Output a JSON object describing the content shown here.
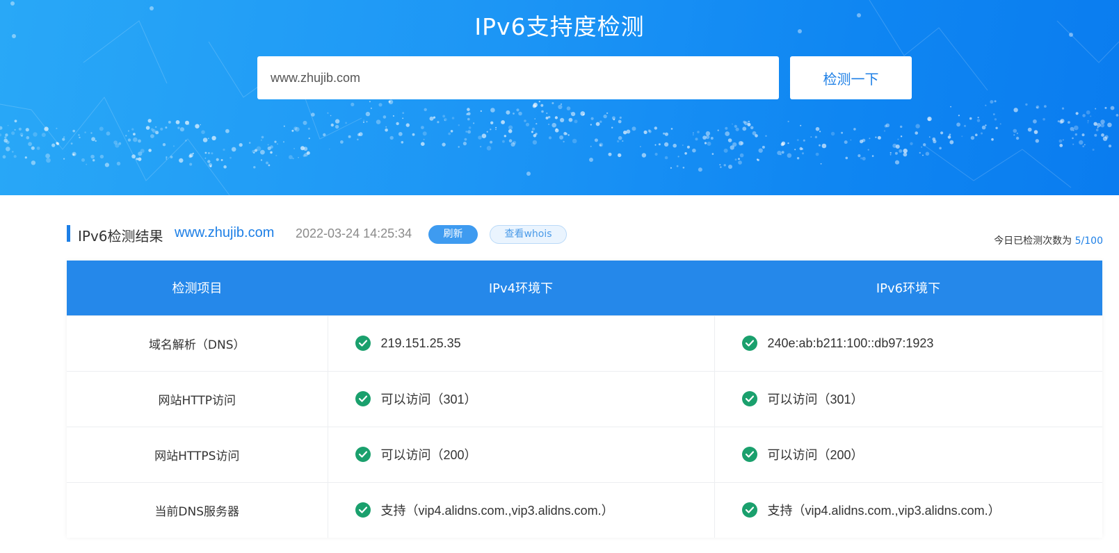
{
  "hero": {
    "title": "IPv6支持度检测",
    "search_value": "www.zhujib.com",
    "search_button": "检测一下"
  },
  "result": {
    "title": "IPv6检测结果",
    "domain": "www.zhujib.com",
    "timestamp": "2022-03-24 14:25:34",
    "refresh_label": "刷新",
    "whois_label": "查看whois",
    "count_label": "今日已检测次数为",
    "count_value": "5/100"
  },
  "table": {
    "headers": [
      "检测项目",
      "IPv4环境下",
      "IPv6环境下"
    ],
    "rows": [
      {
        "item": "域名解析（DNS）",
        "ipv4": "219.151.25.35",
        "ipv6": "240e:ab:b211:100::db97:1923"
      },
      {
        "item": "网站HTTP访问",
        "ipv4": "可以访问（301）",
        "ipv6": "可以访问（301）"
      },
      {
        "item": "网站HTTPS访问",
        "ipv4": "可以访问（200）",
        "ipv6": "可以访问（200）"
      },
      {
        "item": "当前DNS服务器",
        "ipv4": "支持（vip4.alidns.com.,vip3.alidns.com.）",
        "ipv6": "支持（vip4.alidns.com.,vip3.alidns.com.）"
      }
    ]
  },
  "icons": {
    "status": "check-circle-icon",
    "status_color": "#1aa06d"
  },
  "colors": {
    "accent": "#1d7fe6",
    "header_bg": "#2588ea",
    "banner_start": "#29a8f7",
    "banner_end": "#0a7cef"
  }
}
